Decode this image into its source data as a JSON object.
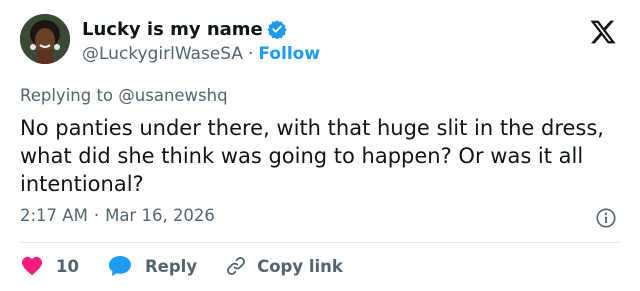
{
  "author": {
    "name": "Lucky is my name",
    "handle": "@LuckygirlWaseSA",
    "separator": "·",
    "follow_label": "Follow"
  },
  "reply_context": {
    "prefix": "Replying to",
    "handle": "@usanewshq"
  },
  "tweet": {
    "text": "No panties under there, with that huge slit in the dress, what did she think was going to happen? Or was it all intentional?",
    "time": "2:17 AM",
    "separator": "·",
    "date": "Mar 16, 2026"
  },
  "actions": {
    "like_count": "10",
    "reply_label": "Reply",
    "copy_link_label": "Copy link"
  },
  "colors": {
    "accent": "#1d9bf0",
    "like": "#f91880",
    "muted": "#536471",
    "text": "#0f1419"
  },
  "icons": [
    "verified-badge-icon",
    "x-logo-icon",
    "info-icon",
    "heart-icon",
    "reply-bubble-icon",
    "link-icon"
  ]
}
